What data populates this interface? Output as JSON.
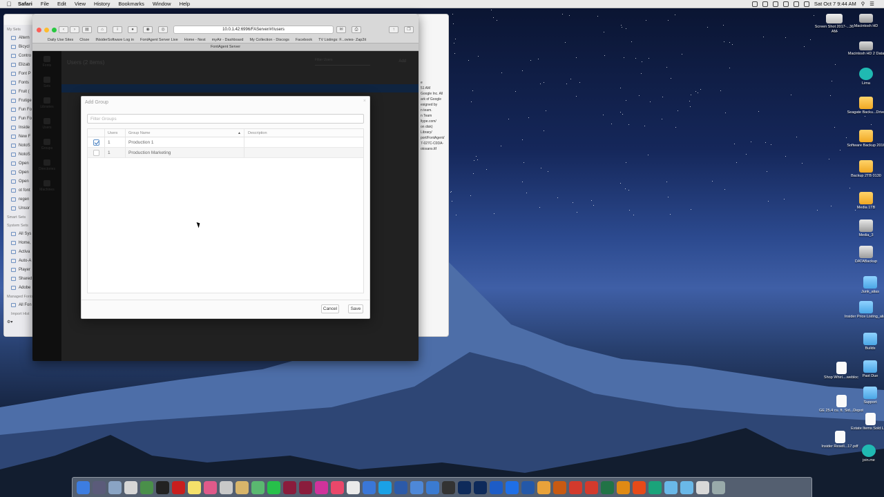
{
  "menubar": {
    "app": "Safari",
    "items": [
      "File",
      "Edit",
      "View",
      "History",
      "Bookmarks",
      "Window",
      "Help"
    ],
    "clock": "Sat Oct 7  9:44 AM"
  },
  "finder": {
    "sections": {
      "my_sets": "My Sets",
      "smart_sets": "Smart Sets",
      "system_sets": "System Sets",
      "managed": "Managed Fonts",
      "import": "Import Hist"
    },
    "my_sets_items": [
      "Altern",
      "Bicycl",
      "Contro",
      "Elizab",
      "Font P",
      "Fonts",
      "Fruit (",
      "Frutige",
      "Fun Fo",
      "Fun Fo",
      "Inside",
      "New F",
      "NotoS",
      "NotoS",
      "Open",
      "Open",
      "Open",
      "ot font",
      "regen",
      "Unsor"
    ],
    "system_items": [
      "All Sys",
      "Home,",
      "Activa",
      "Auto-A",
      "Player",
      "Shared",
      "Adobe"
    ],
    "managed_items": [
      "All Fon"
    ],
    "right_text": [
      "e",
      "51 AM",
      "Google Inc. All",
      "ark of Google",
      "esigned by",
      "n team.",
      "n Team",
      "ltype.com/",
      "on disk)",
      "Library/",
      "port/FontAgent/",
      "7-027C-C0DA-",
      "otosans.ttf"
    ]
  },
  "safari": {
    "url": "10.0.1.42:6996/FAServer/#!/users",
    "bookmarks": [
      "Daily Use Sites",
      "Cloze",
      "INsiderSoftware Log in",
      "FontAgent Server Live",
      "Home - Nest",
      "myAir - Dashboard",
      "My Collection - Discogs",
      "Facebook",
      "TV Listings: F...ovies- Zap2it"
    ],
    "tab_title": "FontAgent Server"
  },
  "app": {
    "nav": [
      "Fonts",
      "Sets",
      "Libraries",
      "Users",
      "Groups",
      "Directories",
      "Machines"
    ],
    "page_title": "Users (2 items)",
    "add_label": "Add",
    "filter_placeholder": "Filter Users"
  },
  "modal": {
    "title": "Add Group",
    "filter_placeholder": "Filter Groups",
    "columns": {
      "users": "Users",
      "name": "Group Name",
      "description": "Description"
    },
    "rows": [
      {
        "checked": true,
        "users": "1",
        "name": "Production 1",
        "description": ""
      },
      {
        "checked": false,
        "users": "1",
        "name": "Production Marketing",
        "description": ""
      }
    ],
    "cancel_label": "Cancel",
    "save_label": "Save"
  },
  "desktop": {
    "icons": [
      {
        "label": "Screen Shot 2017-...36 AM",
        "icon": "screenshot-icon"
      },
      {
        "label": "Macintosh HD",
        "icon": "hard-drive-icon"
      },
      {
        "label": "Macintosh HD 2 Data",
        "icon": "hard-drive-icon"
      },
      {
        "label": "Lima",
        "icon": "lima-icon"
      },
      {
        "label": "Seagate Backu...Drive",
        "icon": "drive-icon"
      },
      {
        "label": "Software Backup 2016",
        "icon": "drive-icon"
      },
      {
        "label": "Backup 2TB 0130",
        "icon": "drive-icon"
      },
      {
        "label": "Media 1TB",
        "icon": "drive-icon"
      },
      {
        "label": "Media_3",
        "icon": "network-drive-icon"
      },
      {
        "label": "DATABackup",
        "icon": "network-drive-icon"
      },
      {
        "label": "Junk_alias",
        "icon": "folder-icon"
      },
      {
        "label": "Insider Price Listing_alias",
        "icon": "folder-icon"
      },
      {
        "label": "Builds",
        "icon": "folder-icon"
      },
      {
        "label": "Past Due",
        "icon": "folder-icon"
      },
      {
        "label": "Shop Whirl....webloc",
        "icon": "webloc-icon"
      },
      {
        "label": "Support",
        "icon": "folder-icon"
      },
      {
        "label": "GE 25.4 cu. ft. Sid...Depot",
        "icon": "webloc-icon"
      },
      {
        "label": "Estate Items Sold Lehr",
        "icon": "document-icon"
      },
      {
        "label": "Insider Resell...17.pdf",
        "icon": "pdf-icon"
      },
      {
        "label": "join.me",
        "icon": "joinme-icon"
      }
    ]
  },
  "colors": {
    "accent": "#2d6cb8",
    "selected_row": "#1b3f6e",
    "app_dark": "#3a3a3a"
  }
}
